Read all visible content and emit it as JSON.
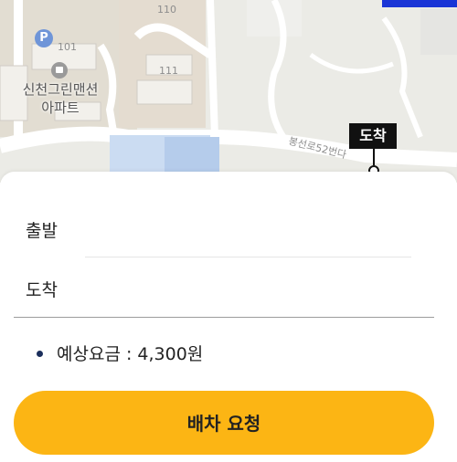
{
  "map": {
    "building_labels": [
      "110",
      "101",
      "111"
    ],
    "apartment_name_line1": "신천그린맨션",
    "apartment_name_line2": "아파트",
    "parking_icon_text": "P",
    "road_name": "봉선로52번다",
    "arrival_tag": "도착"
  },
  "sheet": {
    "departure_label": "출발",
    "arrival_label": "도착",
    "fare_text": "예상요금 : 4,300원",
    "request_button": "배차 요청"
  },
  "colors": {
    "accent": "#fcb514",
    "route": "#1a35d6",
    "bullet": "#1b2f5c"
  }
}
